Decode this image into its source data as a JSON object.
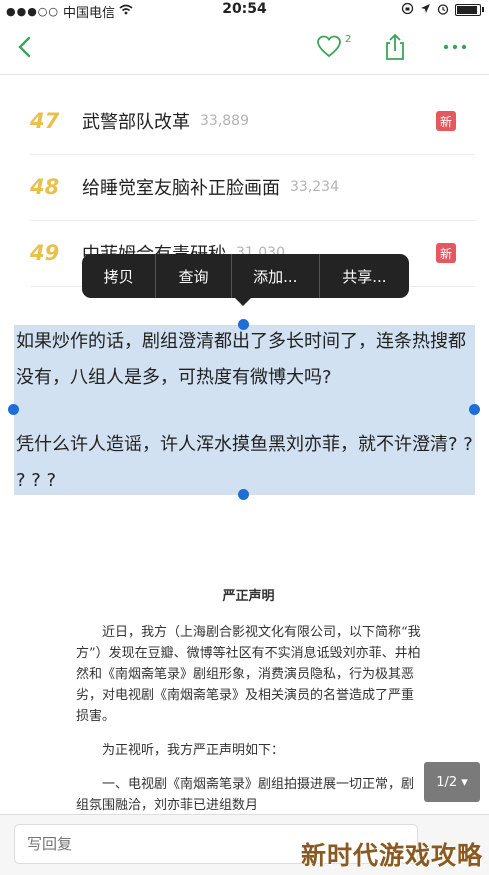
{
  "status_bar": {
    "signal": "●●●○○",
    "carrier": "中国电信",
    "wifi_icon": "wifi-icon",
    "time": "20:54",
    "icons": [
      "lock-rotation-icon",
      "location-icon",
      "alarm-icon",
      "battery-icon"
    ]
  },
  "nav": {
    "back_icon": "chevron-left-icon",
    "like_count": "2",
    "share_icon": "share-icon",
    "more_icon": "more-icon",
    "accent_color": "#3aa55a"
  },
  "hot_list": [
    {
      "rank": "47",
      "title": "武警部队改革",
      "count": "33,889",
      "badge": "新"
    },
    {
      "rank": "48",
      "title": "给睡觉室友脑补正脸画面",
      "count": "33,234",
      "badge": ""
    },
    {
      "rank": "49",
      "title": "中菲姆合有毒研秒",
      "count": "31,030",
      "badge": "新"
    }
  ],
  "context_menu": {
    "items": [
      "拷贝",
      "查询",
      "添加...",
      "共享..."
    ]
  },
  "selected_text": {
    "p1": "如果炒作的话，剧组澄清都出了多长时间了，连条热搜都没有，八组人是多，可热度有微博大吗?",
    "p2": "凭什么许人造谣，许人浑水摸鱼黑刘亦菲，就不许澄清? ? ? ? ?"
  },
  "document": {
    "title": "严正声明",
    "p1": "近日，我方（上海剧合影视文化有限公司，以下简称“我方”）发现在豆瓣、微博等社区有不实消息诋毁刘亦菲、井柏然和《南烟斋笔录》剧组形象，消费演员隐私，行为极其恶劣，对电视剧《南烟斋笔录》及相关演员的名誉造成了严重损害。",
    "p2": "为正视听，我方严正声明如下：",
    "p3": "一、电视剧《南烟斋笔录》剧组拍摄进展一切正常，剧组氛围融洽，刘亦菲已进组数月"
  },
  "pager": {
    "label": "1/2 ▾"
  },
  "reply": {
    "placeholder": "写回复"
  },
  "watermark": "新时代游戏攻略"
}
